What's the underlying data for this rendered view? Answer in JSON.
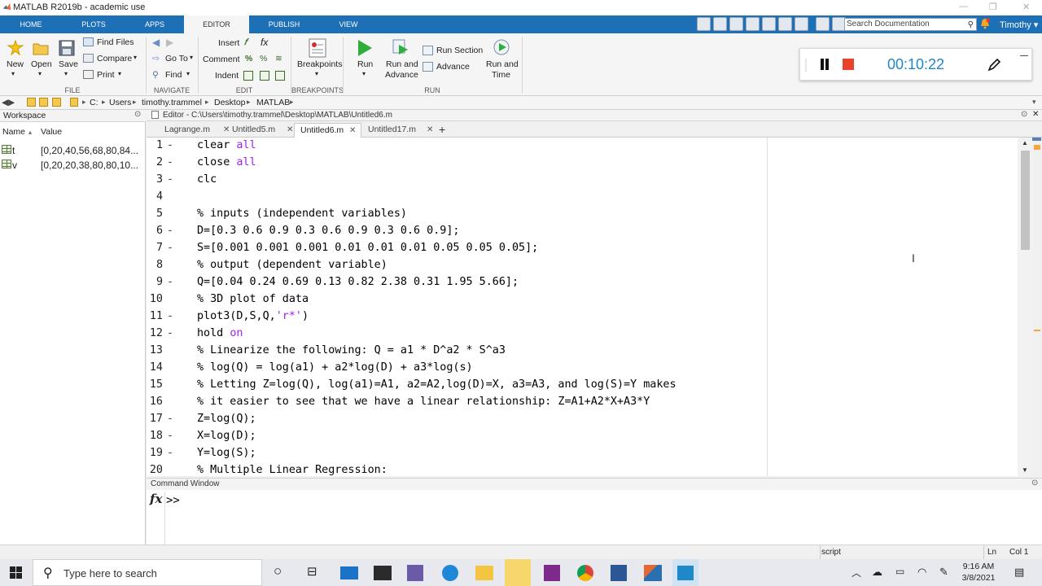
{
  "window": {
    "title": "MATLAB R2019b - academic use"
  },
  "ribbon_tabs": [
    "HOME",
    "PLOTS",
    "APPS",
    "EDITOR",
    "PUBLISH",
    "VIEW"
  ],
  "active_tab": "EDITOR",
  "search": {
    "placeholder": "Search Documentation"
  },
  "user": {
    "name": "Timothy"
  },
  "file_group": {
    "new": "New",
    "open": "Open",
    "save": "Save",
    "find_files": "Find Files",
    "compare": "Compare",
    "print": "Print",
    "label": "FILE"
  },
  "navigate_group": {
    "go_to": "Go To",
    "find": "Find",
    "label": "NAVIGATE"
  },
  "edit_group": {
    "insert": "Insert",
    "comment": "Comment",
    "indent": "Indent",
    "label": "EDIT"
  },
  "breakpoints_group": {
    "breakpoints": "Breakpoints",
    "label": "BREAKPOINTS"
  },
  "run_group": {
    "run": "Run",
    "run_and_advance_1": "Run and",
    "run_and_advance_2": "Advance",
    "run_section": "Run Section",
    "advance": "Advance",
    "run_and_time_1": "Run and",
    "run_and_time_2": "Time",
    "label": "RUN"
  },
  "recorder": {
    "elapsed": "00:10:22"
  },
  "address": {
    "segments": [
      "C:",
      "Users",
      "timothy.trammel",
      "Desktop",
      "MATLAB"
    ]
  },
  "workspace": {
    "title": "Workspace",
    "col_name": "Name",
    "col_value": "Value",
    "vars": [
      {
        "name": "t",
        "value": "[0,20,40,56,68,80,84..."
      },
      {
        "name": "v",
        "value": "[0,20,20,38,80,80,10..."
      }
    ]
  },
  "editor": {
    "header": "Editor - C:\\Users\\timothy.trammel\\Desktop\\MATLAB\\Untitled6.m",
    "tabs": [
      "Lagrange.m",
      "Untitled5.m",
      "Untitled6.m",
      "Untitled17.m"
    ],
    "active_tab": "Untitled6.m",
    "line_numbers": [
      "1",
      "2",
      "3",
      "4",
      "5",
      "6",
      "7",
      "8",
      "9",
      "10",
      "11",
      "12",
      "13",
      "14",
      "15",
      "16",
      "17",
      "18",
      "19",
      "20"
    ],
    "code": {
      "l1_a": "clear ",
      "l1_b": "all",
      "l2_a": "close ",
      "l2_b": "all",
      "l3": "clc",
      "l4": "",
      "l5": "% inputs (independent variables)",
      "l6": "D=[0.3 0.6 0.9 0.3 0.6 0.9 0.3 0.6 0.9];",
      "l7": "S=[0.001 0.001 0.001 0.01 0.01 0.01 0.05 0.05 0.05];",
      "l8": "% output (dependent variable)",
      "l9": "Q=[0.04 0.24 0.69 0.13 0.82 2.38 0.31 1.95 5.66];",
      "l10": "% 3D plot of data",
      "l11_a": "plot3(D,S,Q,",
      "l11_b": "'r*'",
      "l11_c": ")",
      "l12_a": "hold ",
      "l12_b": "on",
      "l13": "% Linearize the following: Q = a1 * D^a2 * S^a3",
      "l14": "% log(Q) = log(a1) + a2*log(D) + a3*log(s)",
      "l15": "% Letting Z=log(Q), log(a1)=A1, a2=A2,log(D)=X, a3=A3, and log(S)=Y makes",
      "l16": "% it easier to see that we have a linear relationship: Z=A1+A2*X+A3*Y",
      "l17": "Z=log(Q);",
      "l18": "X=log(D);",
      "l19": "Y=log(S);",
      "l20": "% Multiple Linear Regression:"
    }
  },
  "command_window": {
    "title": "Command Window",
    "prompt": ">>"
  },
  "status": {
    "mode": "script",
    "ln": "Ln",
    "col": "Col 1"
  },
  "taskbar": {
    "search_text": "Type here to search",
    "time": "9:16 AM",
    "date": "3/8/2021"
  },
  "colors": {
    "ribbon_blue": "#1d6fb6",
    "keyword": "#a020f0",
    "comment": "#228b22",
    "timer": "#1e88c8"
  }
}
